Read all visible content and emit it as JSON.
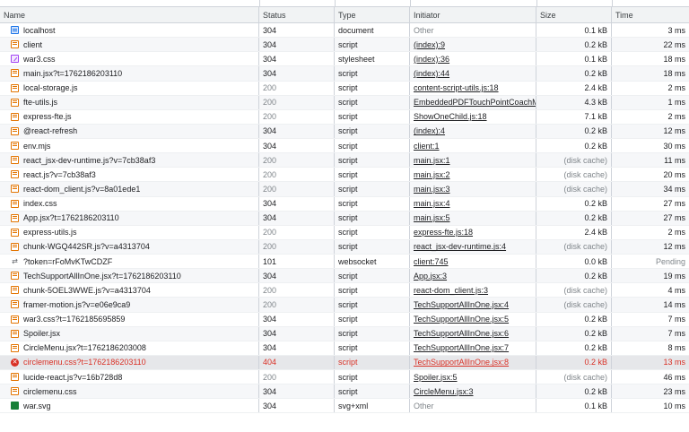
{
  "columns": {
    "name": "Name",
    "status": "Status",
    "type": "Type",
    "initiator": "Initiator",
    "size": "Size",
    "time": "Time"
  },
  "rows": [
    {
      "name": "localhost",
      "icon": "document-icon",
      "status": "304",
      "type": "document",
      "initiator": "Other",
      "size": "0.1 kB",
      "time": "3 ms"
    },
    {
      "name": "client",
      "icon": "script-icon",
      "status": "304",
      "type": "script",
      "initiator": "(index):9",
      "size": "0.2 kB",
      "time": "22 ms"
    },
    {
      "name": "war3.css",
      "icon": "stylesheet-icon",
      "status": "304",
      "type": "stylesheet",
      "initiator": "(index):36",
      "size": "0.1 kB",
      "time": "18 ms"
    },
    {
      "name": "main.jsx?t=1762186203110",
      "icon": "script-icon",
      "status": "304",
      "type": "script",
      "initiator": "(index):44",
      "size": "0.2 kB",
      "time": "18 ms"
    },
    {
      "name": "local-storage.js",
      "icon": "script-icon",
      "status": "200",
      "type": "script",
      "initiator": "content-script-utils.js:18",
      "size": "2.4 kB",
      "time": "2 ms"
    },
    {
      "name": "fte-utils.js",
      "icon": "script-icon",
      "status": "200",
      "type": "script",
      "initiator": "EmbeddedPDFTouchPointCoachM",
      "size": "4.3 kB",
      "time": "1 ms"
    },
    {
      "name": "express-fte.js",
      "icon": "script-icon",
      "status": "200",
      "type": "script",
      "initiator": "ShowOneChild.js:18",
      "size": "7.1 kB",
      "time": "2 ms"
    },
    {
      "name": "@react-refresh",
      "icon": "script-icon",
      "status": "304",
      "type": "script",
      "initiator": "(index):4",
      "size": "0.2 kB",
      "time": "12 ms"
    },
    {
      "name": "env.mjs",
      "icon": "script-icon",
      "status": "304",
      "type": "script",
      "initiator": "client:1",
      "size": "0.2 kB",
      "time": "30 ms"
    },
    {
      "name": "react_jsx-dev-runtime.js?v=7cb38af3",
      "icon": "script-icon",
      "status": "200",
      "type": "script",
      "initiator": "main.jsx:1",
      "size": "(disk cache)",
      "time": "11 ms"
    },
    {
      "name": "react.js?v=7cb38af3",
      "icon": "script-icon",
      "status": "200",
      "type": "script",
      "initiator": "main.jsx:2",
      "size": "(disk cache)",
      "time": "20 ms"
    },
    {
      "name": "react-dom_client.js?v=8a01ede1",
      "icon": "script-icon",
      "status": "200",
      "type": "script",
      "initiator": "main.jsx:3",
      "size": "(disk cache)",
      "time": "34 ms"
    },
    {
      "name": "index.css",
      "icon": "script-icon",
      "status": "304",
      "type": "script",
      "initiator": "main.jsx:4",
      "size": "0.2 kB",
      "time": "27 ms"
    },
    {
      "name": "App.jsx?t=1762186203110",
      "icon": "script-icon",
      "status": "304",
      "type": "script",
      "initiator": "main.jsx:5",
      "size": "0.2 kB",
      "time": "27 ms"
    },
    {
      "name": "express-utils.js",
      "icon": "script-icon",
      "status": "200",
      "type": "script",
      "initiator": "express-fte.js:18",
      "size": "2.4 kB",
      "time": "2 ms"
    },
    {
      "name": "chunk-WGQ442SR.js?v=a4313704",
      "icon": "script-icon",
      "status": "200",
      "type": "script",
      "initiator": "react_jsx-dev-runtime.js:4",
      "size": "(disk cache)",
      "time": "12 ms"
    },
    {
      "name": "?token=rFoMvKTwCDZF",
      "icon": "websocket-icon",
      "status": "101",
      "type": "websocket",
      "initiator": "client:745",
      "size": "0.0 kB",
      "time": "Pending"
    },
    {
      "name": "TechSupportAllInOne.jsx?t=1762186203110",
      "icon": "script-icon",
      "status": "304",
      "type": "script",
      "initiator": "App.jsx:3",
      "size": "0.2 kB",
      "time": "19 ms"
    },
    {
      "name": "chunk-5OEL3WWE.js?v=a4313704",
      "icon": "script-icon",
      "status": "200",
      "type": "script",
      "initiator": "react-dom_client.js:3",
      "size": "(disk cache)",
      "time": "4 ms"
    },
    {
      "name": "framer-motion.js?v=e06e9ca9",
      "icon": "script-icon",
      "status": "200",
      "type": "script",
      "initiator": "TechSupportAllInOne.jsx:4",
      "size": "(disk cache)",
      "time": "14 ms"
    },
    {
      "name": "war3.css?t=1762185695859",
      "icon": "script-icon",
      "status": "304",
      "type": "script",
      "initiator": "TechSupportAllInOne.jsx:5",
      "size": "0.2 kB",
      "time": "7 ms"
    },
    {
      "name": "Spoiler.jsx",
      "icon": "script-icon",
      "status": "304",
      "type": "script",
      "initiator": "TechSupportAllInOne.jsx:6",
      "size": "0.2 kB",
      "time": "7 ms"
    },
    {
      "name": "CircleMenu.jsx?t=1762186203008",
      "icon": "script-icon",
      "status": "304",
      "type": "script",
      "initiator": "TechSupportAllInOne.jsx:7",
      "size": "0.2 kB",
      "time": "8 ms"
    },
    {
      "name": "circlemenu.css?t=1762186203110",
      "icon": "error-icon",
      "status": "404",
      "type": "script",
      "initiator": "TechSupportAllInOne.jsx:8",
      "size": "0.2 kB",
      "time": "13 ms"
    },
    {
      "name": "lucide-react.js?v=16b728d8",
      "icon": "script-icon",
      "status": "200",
      "type": "script",
      "initiator": "Spoiler.jsx:5",
      "size": "(disk cache)",
      "time": "46 ms"
    },
    {
      "name": "circlemenu.css",
      "icon": "script-icon",
      "status": "304",
      "type": "script",
      "initiator": "CircleMenu.jsx:3",
      "size": "0.2 kB",
      "time": "23 ms"
    },
    {
      "name": "war.svg",
      "icon": "image-icon",
      "status": "304",
      "type": "svg+xml",
      "initiator": "Other",
      "size": "0.1 kB",
      "time": "10 ms"
    }
  ]
}
